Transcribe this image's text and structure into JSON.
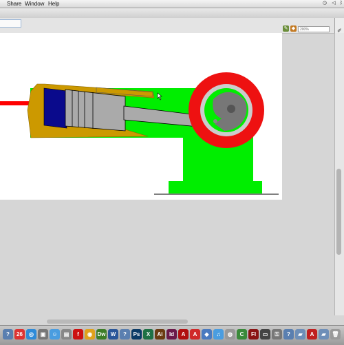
{
  "menubar": {
    "items": [
      {
        "label": "Share",
        "name": "menu-share"
      },
      {
        "label": "Window",
        "name": "menu-window"
      },
      {
        "label": "Help",
        "name": "menu-help"
      }
    ]
  },
  "toolbar": {
    "zoom_value": "200%"
  },
  "engine_drawing": {
    "colors": {
      "base": "#00ee00",
      "flywheel_rim": "#ee1111",
      "flywheel_hub": "#777777",
      "cylinder": "#cc9900",
      "piston_cap": "#0a0a8c",
      "piston": "#aaaaaa",
      "rod": "#ff0000"
    }
  },
  "right_panel": {
    "icons": [
      "brush-icon",
      "grid-icon",
      "stack-icon",
      "info-icon",
      "transform-icon",
      "swatch-icon",
      "link-icon",
      "paint-bucket-icon",
      "color-icon",
      "pen-icon",
      "layers-icon"
    ]
  },
  "dock": {
    "apps": [
      {
        "name": "help-app-icon",
        "glyph": "?",
        "color": "#5a7fb0"
      },
      {
        "name": "calendar-app-icon",
        "glyph": "26",
        "color": "#d33"
      },
      {
        "name": "safari-app-icon",
        "glyph": "◎",
        "color": "#2e8bd8"
      },
      {
        "name": "photos-app-icon",
        "glyph": "▣",
        "color": "#777"
      },
      {
        "name": "finder-app-icon",
        "glyph": "☺",
        "color": "#4a9de0"
      },
      {
        "name": "preview-app-icon",
        "glyph": "▤",
        "color": "#888"
      },
      {
        "name": "flash-app-icon",
        "glyph": "f",
        "color": "#c11"
      },
      {
        "name": "chrome-app-icon",
        "glyph": "◉",
        "color": "#e0a21c"
      },
      {
        "name": "dreamweaver-app-icon",
        "glyph": "Dw",
        "color": "#3d7d28"
      },
      {
        "name": "word-app-icon",
        "glyph": "W",
        "color": "#2a5699"
      },
      {
        "name": "help-app-icon-2",
        "glyph": "?",
        "color": "#5a7fb0"
      },
      {
        "name": "photoshop-app-icon",
        "glyph": "Ps",
        "color": "#0b3b66"
      },
      {
        "name": "excel-app-icon",
        "glyph": "X",
        "color": "#1e7145"
      },
      {
        "name": "illustrator-app-icon",
        "glyph": "Ai",
        "color": "#6b3b12"
      },
      {
        "name": "indesign-app-icon",
        "glyph": "Id",
        "color": "#6c1a4a"
      },
      {
        "name": "acrobat-app-icon",
        "glyph": "A",
        "color": "#b01010"
      },
      {
        "name": "acrobat-app-icon-2",
        "glyph": "A",
        "color": "#d02a2a"
      },
      {
        "name": "keynote-app-icon",
        "glyph": "◆",
        "color": "#4a7ac0"
      },
      {
        "name": "itunes-app-icon",
        "glyph": "♫",
        "color": "#4a9de0"
      },
      {
        "name": "disc-app-icon",
        "glyph": "◍",
        "color": "#999"
      },
      {
        "name": "camtasia-app-icon",
        "glyph": "C",
        "color": "#3a8a3a"
      },
      {
        "name": "fireworks-app-icon",
        "glyph": "Fl",
        "color": "#8a1414"
      },
      {
        "name": "monitor-app-icon",
        "glyph": "▭",
        "color": "#444"
      },
      {
        "name": "lock-app-icon",
        "glyph": "⚿",
        "color": "#777"
      },
      {
        "name": "help-app-icon-3",
        "glyph": "?",
        "color": "#5a7fb0"
      },
      {
        "name": "folder-app-icon",
        "glyph": "▰",
        "color": "#6e8fb8"
      },
      {
        "name": "acrobat-app-icon-3",
        "glyph": "A",
        "color": "#c02020"
      },
      {
        "name": "folder-app-icon-2",
        "glyph": "▰",
        "color": "#6e8fb8"
      },
      {
        "name": "trash-app-icon",
        "glyph": "🗑",
        "color": "#9a9a9a"
      }
    ]
  }
}
